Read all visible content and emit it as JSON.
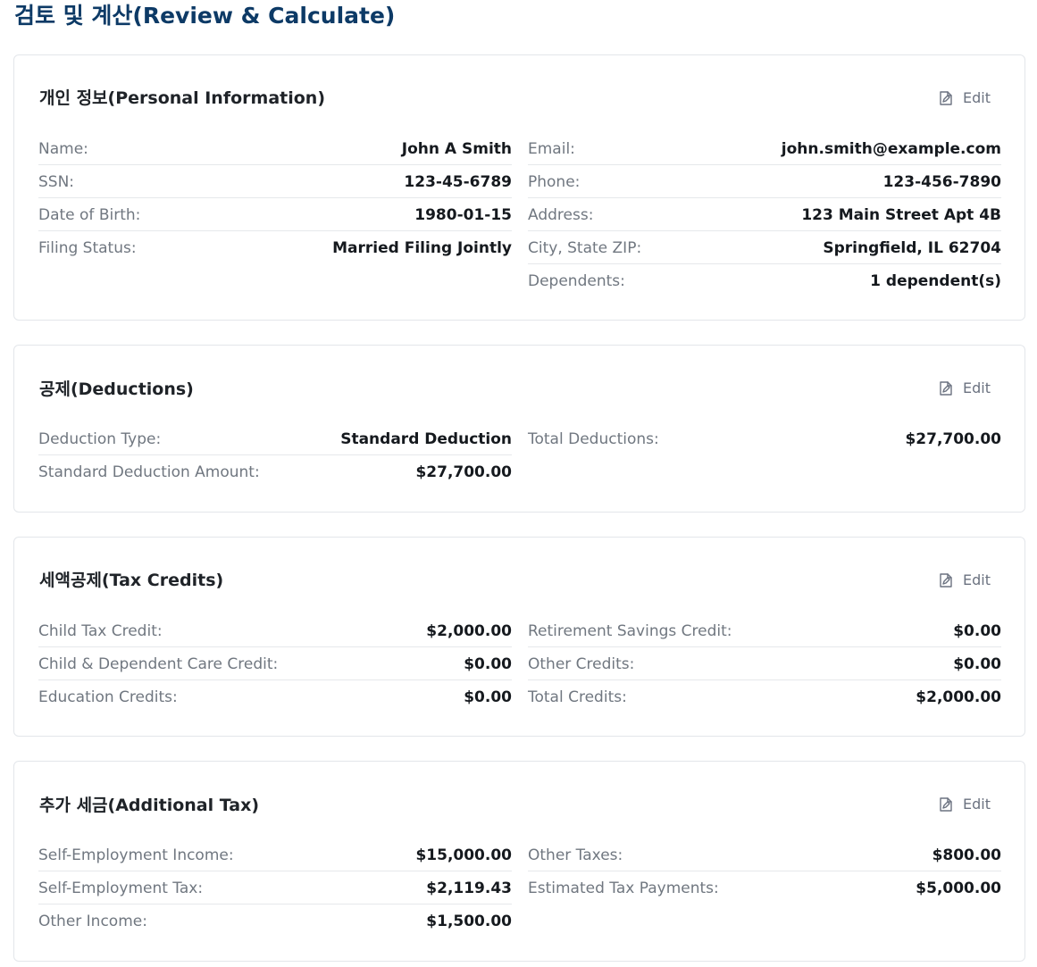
{
  "page": {
    "title": "검토 및 계산(Review & Calculate)"
  },
  "common": {
    "edit_label": "Edit"
  },
  "sections": [
    {
      "title": "개인 정보(Personal Information)",
      "left": [
        {
          "label": "Name:",
          "value": "John A Smith"
        },
        {
          "label": "SSN:",
          "value": "123-45-6789"
        },
        {
          "label": "Date of Birth:",
          "value": "1980-01-15"
        },
        {
          "label": "Filing Status:",
          "value": "Married Filing Jointly"
        }
      ],
      "right": [
        {
          "label": "Email:",
          "value": "john.smith@example.com"
        },
        {
          "label": "Phone:",
          "value": "123-456-7890"
        },
        {
          "label": "Address:",
          "value": "123 Main Street Apt 4B"
        },
        {
          "label": "City, State ZIP:",
          "value": "Springfield, IL 62704"
        },
        {
          "label": "Dependents:",
          "value": "1 dependent(s)"
        }
      ]
    },
    {
      "title": "공제(Deductions)",
      "left": [
        {
          "label": "Deduction Type:",
          "value": "Standard Deduction"
        },
        {
          "label": "Standard Deduction Amount:",
          "value": "$27,700.00"
        }
      ],
      "right": [
        {
          "label": "Total Deductions:",
          "value": "$27,700.00"
        }
      ]
    },
    {
      "title": "세액공제(Tax Credits)",
      "left": [
        {
          "label": "Child Tax Credit:",
          "value": "$2,000.00"
        },
        {
          "label": "Child & Dependent Care Credit:",
          "value": "$0.00"
        },
        {
          "label": "Education Credits:",
          "value": "$0.00"
        }
      ],
      "right": [
        {
          "label": "Retirement Savings Credit:",
          "value": "$0.00"
        },
        {
          "label": "Other Credits:",
          "value": "$0.00"
        },
        {
          "label": "Total Credits:",
          "value": "$2,000.00"
        }
      ]
    },
    {
      "title": "추가 세금(Additional Tax)",
      "left": [
        {
          "label": "Self-Employment Income:",
          "value": "$15,000.00"
        },
        {
          "label": "Self-Employment Tax:",
          "value": "$2,119.43"
        },
        {
          "label": "Other Income:",
          "value": "$1,500.00"
        }
      ],
      "right": [
        {
          "label": "Other Taxes:",
          "value": "$800.00"
        },
        {
          "label": "Estimated Tax Payments:",
          "value": "$5,000.00"
        }
      ]
    }
  ]
}
